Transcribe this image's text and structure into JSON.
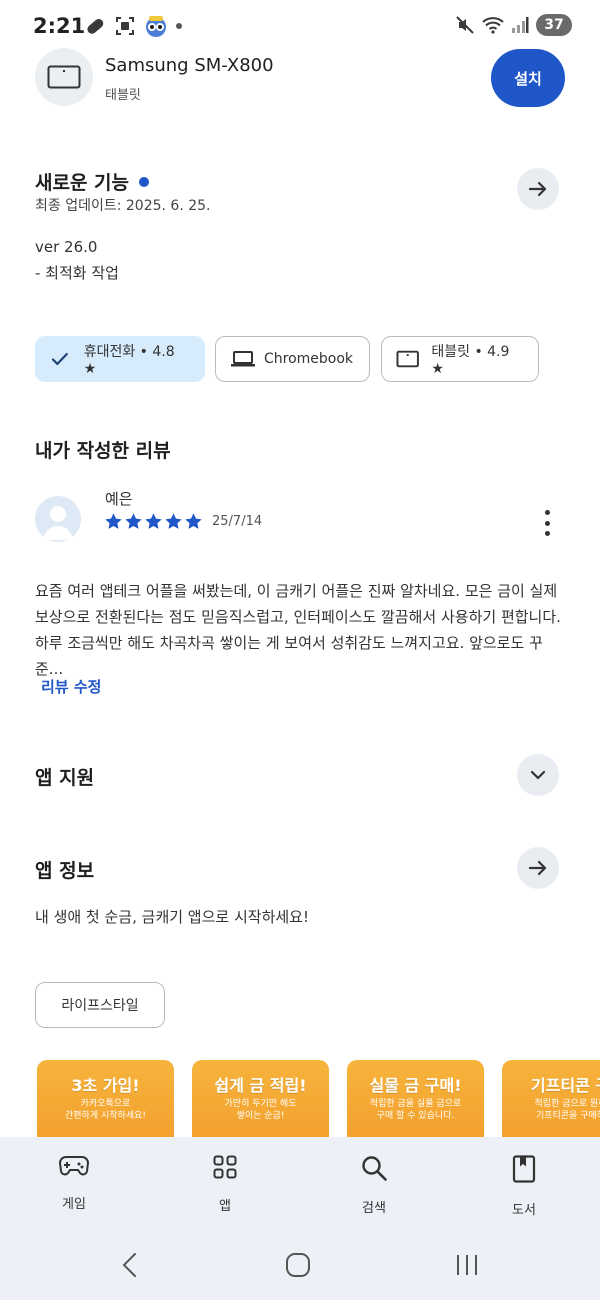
{
  "status_bar": {
    "time": "2:21",
    "battery": "37"
  },
  "device": {
    "name": "Samsung SM-X800",
    "type": "태블릿",
    "install_label": "설치"
  },
  "whats_new": {
    "title": "새로운 기능",
    "updated": "최종 업데이트: 2025. 6. 25.",
    "version": "ver 26.0",
    "note": "- 최적화 작업"
  },
  "device_chips": [
    {
      "label": "휴대전화 • 4.8 ★",
      "selected": true,
      "icon": "check-icon"
    },
    {
      "label": "Chromebook",
      "selected": false,
      "icon": "laptop-icon"
    },
    {
      "label": "태블릿 • 4.9 ★",
      "selected": false,
      "icon": "tablet-icon"
    }
  ],
  "my_review": {
    "title": "내가 작성한 리뷰",
    "reviewer": "예은",
    "rating": 5,
    "date": "25/7/14",
    "lines": [
      "요즘 여러 앱테크 어플을 써봤는데, 이 금캐기 어플은 진짜 알차네요. 모은 금이 실제",
      "보상으로 전환된다는 점도 믿음직스럽고, 인터페이스도 깔끔해서 사용하기 편합니다.",
      "하루 조금씩만 해도 차곡차곡 쌓이는 게 보여서 성취감도 느껴지고요. 앞으로도 꾸준..."
    ],
    "edit_label": "리뷰 수정"
  },
  "app_support": {
    "title": "앱 지원"
  },
  "app_info": {
    "title": "앱 정보",
    "description": "내 생애 첫 순금, 금캐기 앱으로 시작하세요!",
    "category": "라이프스타일"
  },
  "screenshots": [
    {
      "title": "3초 가입!",
      "sub1": "카카오톡으로",
      "sub2": "간편하게 시작하세요!"
    },
    {
      "title": "쉽게 금 적립!",
      "sub1": "가만히 두기만 해도",
      "sub2": "쌓이는 순금!"
    },
    {
      "title": "실물 금 구매!",
      "sub1": "적립한 금을 실물 금으로",
      "sub2": "구매 할 수 있습니다."
    },
    {
      "title": "기프티콘 구",
      "sub1": "적립한 금으로 원하",
      "sub2": "기프티콘을 구매하"
    }
  ],
  "bottom_nav": [
    {
      "label": "게임",
      "icon": "gamepad-icon"
    },
    {
      "label": "앱",
      "icon": "apps-grid-icon"
    },
    {
      "label": "검색",
      "icon": "search-icon"
    },
    {
      "label": "도서",
      "icon": "book-icon"
    }
  ],
  "colors": {
    "accent": "#1f57c8",
    "chip_selected": "#d6ebfb",
    "nav_background": "#edf1f7",
    "screenshot_orange": "#f39b2a"
  }
}
